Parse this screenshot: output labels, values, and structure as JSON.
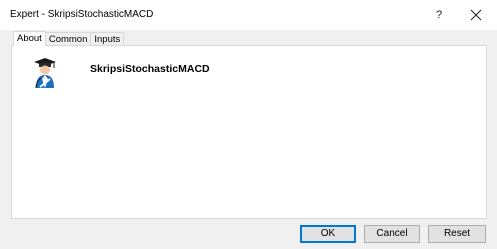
{
  "window": {
    "title": "Expert - SkripsiStochasticMACD",
    "help_label": "?"
  },
  "tabs": [
    {
      "label": "About",
      "active": true
    },
    {
      "label": "Common",
      "active": false
    },
    {
      "label": "Inputs",
      "active": false
    }
  ],
  "about": {
    "expert_name": "SkripsiStochasticMACD",
    "icon": "graduate-expert-icon"
  },
  "buttons": {
    "ok_label": "OK",
    "cancel_label": "Cancel",
    "reset_label": "Reset"
  },
  "colors": {
    "accent": "#0078d7",
    "icon_blue": "#1f6fc0",
    "icon_dark": "#1b1b1b"
  }
}
